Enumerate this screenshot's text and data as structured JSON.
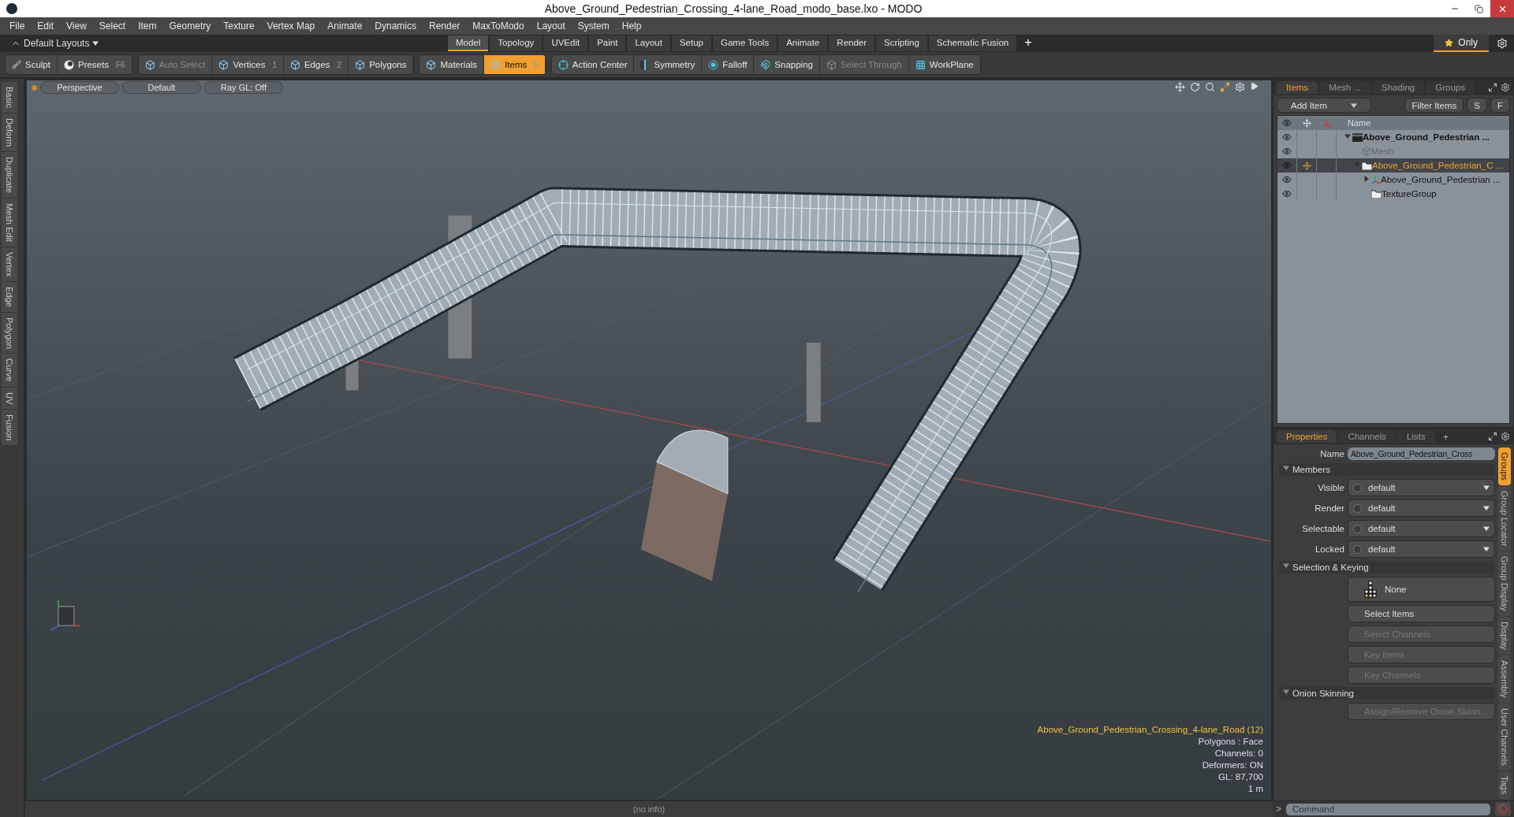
{
  "window": {
    "title": "Above_Ground_Pedestrian_Crossing_4-lane_Road_modo_base.lxo - MODO"
  },
  "menu": [
    "File",
    "Edit",
    "View",
    "Select",
    "Item",
    "Geometry",
    "Texture",
    "Vertex Map",
    "Animate",
    "Dynamics",
    "Render",
    "MaxToModo",
    "Layout",
    "System",
    "Help"
  ],
  "layout_bar": {
    "layouts": "Default Layouts",
    "tabs": [
      {
        "label": "Model",
        "selected": true
      },
      {
        "label": "Topology",
        "selected": false
      },
      {
        "label": "UVEdit",
        "selected": false
      },
      {
        "label": "Paint",
        "selected": false
      },
      {
        "label": "Layout",
        "selected": false
      },
      {
        "label": "Setup",
        "selected": false
      },
      {
        "label": "Game Tools",
        "selected": false
      },
      {
        "label": "Animate",
        "selected": false
      },
      {
        "label": "Render",
        "selected": false
      },
      {
        "label": "Scripting",
        "selected": false
      },
      {
        "label": "Schematic Fusion",
        "selected": false
      }
    ],
    "add": "+",
    "only": "Only"
  },
  "toolbar": [
    [
      {
        "label": "Sculpt",
        "kind": "brush",
        "selected": false,
        "disabled": false
      },
      {
        "label": "Presets",
        "kind": "sphere",
        "shortcut": "F6",
        "selected": false,
        "disabled": false
      }
    ],
    [
      {
        "label": "Auto Select",
        "kind": "cube",
        "selected": false,
        "disabled": true
      },
      {
        "label": "Vertices",
        "kind": "cube",
        "shortcut": "1",
        "selected": false,
        "disabled": false
      },
      {
        "label": "Edges",
        "kind": "cube",
        "shortcut": "2",
        "selected": false,
        "disabled": false
      },
      {
        "label": "Polygons",
        "kind": "cube",
        "selected": false,
        "disabled": false
      }
    ],
    [
      {
        "label": "Materials",
        "kind": "cube",
        "selected": false,
        "disabled": false
      },
      {
        "label": "Items",
        "kind": "cube",
        "shortcut": "5",
        "selected": true,
        "disabled": false
      }
    ],
    [
      {
        "label": "Action Center",
        "kind": "crosshair",
        "selected": false,
        "disabled": false
      },
      {
        "label": "Symmetry",
        "kind": "symmetry",
        "selected": false,
        "disabled": false
      },
      {
        "label": "Falloff",
        "kind": "falloff",
        "selected": false,
        "disabled": false
      },
      {
        "label": "Snapping",
        "kind": "snap",
        "selected": false,
        "disabled": false
      },
      {
        "label": "Select Through",
        "kind": "through",
        "selected": false,
        "disabled": true
      },
      {
        "label": "WorkPlane",
        "kind": "workplane",
        "selected": false,
        "disabled": false
      }
    ]
  ],
  "left_tabs": [
    "Basic",
    "Deform",
    "Duplicate",
    "Mesh Edit",
    "Vertex",
    "Edge",
    "Polygon",
    "Curve",
    "UV",
    "Fusion"
  ],
  "viewport": {
    "buttons": [
      "Perspective",
      "Default",
      "Ray GL: Off"
    ],
    "info": {
      "title": "Above_Ground_Pedestrian_Crossing_4-lane_Road (12)",
      "lines": [
        "Polygons : Face",
        "Channels: 0",
        "Deformers: ON",
        "GL: 87,700",
        "1 m"
      ]
    }
  },
  "status": "(no info)",
  "items_panel": {
    "tabs": [
      {
        "label": "Items",
        "selected": true
      },
      {
        "label": "Mesh ...",
        "selected": false
      },
      {
        "label": "Shading",
        "selected": false
      },
      {
        "label": "Groups",
        "selected": false
      }
    ],
    "add_item": "Add Item",
    "filter": "Filter Items",
    "s": "S",
    "f": "F",
    "column": "Name",
    "tree": [
      {
        "label": "Above_Ground_Pedestrian ...",
        "kind": "scene",
        "selected": false,
        "expanded": true,
        "children": [
          {
            "label": "Mesh",
            "kind": "mesh",
            "selected": false
          },
          {
            "label": "Above_Ground_Pedestrian_C ...",
            "kind": "group",
            "selected": true,
            "expanded": true,
            "children": [
              {
                "label": "Above_Ground_Pedestrian ...",
                "kind": "locator",
                "selected": false,
                "expanded": false
              },
              {
                "label": "TextureGroup",
                "kind": "group",
                "selected": false
              }
            ]
          }
        ]
      }
    ]
  },
  "properties": {
    "tabs": [
      {
        "label": "Properties",
        "selected": true
      },
      {
        "label": "Channels",
        "selected": false
      },
      {
        "label": "Lists",
        "selected": false
      }
    ],
    "add": "+",
    "name_label": "Name",
    "name_value": "Above_Ground_Pedestrian_Cross",
    "sections": [
      {
        "title": "Members",
        "kind": "dropdowns",
        "rows": [
          {
            "label": "Visible",
            "value": "default"
          },
          {
            "label": "Render",
            "value": "default"
          },
          {
            "label": "Selectable",
            "value": "default"
          },
          {
            "label": "Locked",
            "value": "default"
          }
        ]
      },
      {
        "title": "Selection & Keying",
        "kind": "buttons",
        "preset": "None",
        "buttons": [
          {
            "label": "Select Items",
            "disabled": false
          },
          {
            "label": "Select Channels",
            "disabled": true
          },
          {
            "label": "Key Items",
            "disabled": true
          },
          {
            "label": "Key Channels",
            "disabled": true
          }
        ]
      },
      {
        "title": "Onion Skinning",
        "kind": "buttons",
        "buttons": [
          {
            "label": "Assign/Remove Onion Skinn…",
            "disabled": true
          }
        ]
      }
    ],
    "side_tabs": [
      {
        "label": "Groups",
        "selected": true
      },
      {
        "label": "Group Locator",
        "selected": false
      },
      {
        "label": "Group Display",
        "selected": false
      },
      {
        "label": "Display",
        "selected": false
      },
      {
        "label": "Assembly",
        "selected": false
      },
      {
        "label": "User Channels",
        "selected": false
      },
      {
        "label": "Tags",
        "selected": false
      }
    ]
  },
  "command": {
    "prompt": ">",
    "placeholder": "Command"
  }
}
